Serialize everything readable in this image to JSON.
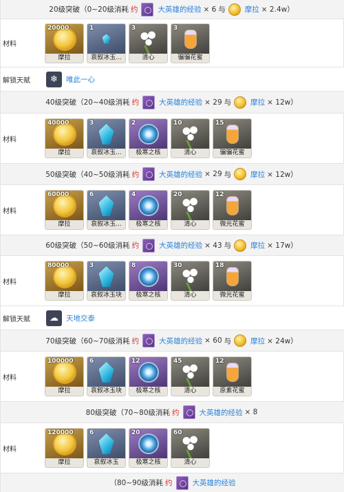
{
  "headers": [
    {
      "prefix": "20级突破（0~20级消耗",
      "yue": "约",
      "exp": "大英雄的经验",
      "exp_count": "× 6",
      "yu": "与",
      "mora": "摩拉",
      "mora_count": "× 2.4w）"
    },
    {
      "prefix": "40级突破（20~40级消耗",
      "yue": "约",
      "exp": "大英雄的经验",
      "exp_count": "× 29",
      "yu": "与",
      "mora": "摩拉",
      "mora_count": "× 12w）"
    },
    {
      "prefix": "50级突破（40~50级消耗",
      "yue": "约",
      "exp": "大英雄的经验",
      "exp_count": "× 29",
      "yu": "与",
      "mora": "摩拉",
      "mora_count": "× 12w）"
    },
    {
      "prefix": "60级突破（50~60级消耗",
      "yue": "约",
      "exp": "大英雄的经验",
      "exp_count": "× 43",
      "yu": "与",
      "mora": "摩拉",
      "mora_count": "× 17w）"
    },
    {
      "prefix": "70级突破（60~70级消耗",
      "yue": "约",
      "exp": "大英雄的经验",
      "exp_count": "× 60",
      "yu": "与",
      "mora": "摩拉",
      "mora_count": "× 24w）"
    },
    {
      "prefix": "80级突破（70~80级消耗",
      "yue": "约",
      "exp": "大英雄的经验",
      "exp_count": "× 8",
      "yu": "",
      "mora": "",
      "mora_count": ""
    },
    {
      "prefix": "（80~90级消耗",
      "yue": "约",
      "exp": "大英雄的经验",
      "exp_count": "",
      "yu": "",
      "mora": "",
      "mora_count": ""
    }
  ],
  "labels": {
    "material": "材料",
    "unlock_talent": "解锁天赋"
  },
  "talents": [
    {
      "name": "唯此一心",
      "icon": "snowflake-talent-icon"
    },
    {
      "name": "天地交泰",
      "icon": "cloud-talent-icon"
    }
  ],
  "materials": [
    [
      {
        "count": "20000",
        "name": "摩拉",
        "icon": "coin"
      },
      {
        "count": "1",
        "name": "哀叙冰玉...",
        "icon": "crystal-small"
      },
      {
        "count": "3",
        "name": "清心",
        "icon": "flower"
      },
      {
        "count": "3",
        "name": "骗骗花蜜",
        "icon": "bottle"
      }
    ],
    [
      {
        "count": "40000",
        "name": "摩拉",
        "icon": "coin"
      },
      {
        "count": "3",
        "name": "哀叙冰玉...",
        "icon": "crystal"
      },
      {
        "count": "2",
        "name": "极寒之核",
        "icon": "core"
      },
      {
        "count": "10",
        "name": "清心",
        "icon": "flower"
      },
      {
        "count": "15",
        "name": "骗骗花蜜",
        "icon": "bottle"
      }
    ],
    [
      {
        "count": "60000",
        "name": "摩拉",
        "icon": "coin"
      },
      {
        "count": "6",
        "name": "哀叙冰玉...",
        "icon": "crystal"
      },
      {
        "count": "4",
        "name": "极寒之核",
        "icon": "core"
      },
      {
        "count": "20",
        "name": "清心",
        "icon": "flower"
      },
      {
        "count": "12",
        "name": "微光花蜜",
        "icon": "bottle"
      }
    ],
    [
      {
        "count": "80000",
        "name": "摩拉",
        "icon": "coin"
      },
      {
        "count": "3",
        "name": "哀叙冰玉块",
        "icon": "crystal"
      },
      {
        "count": "8",
        "name": "极寒之核",
        "icon": "core"
      },
      {
        "count": "30",
        "name": "清心",
        "icon": "flower"
      },
      {
        "count": "18",
        "name": "微光花蜜",
        "icon": "bottle"
      }
    ],
    [
      {
        "count": "100000",
        "name": "摩拉",
        "icon": "coin"
      },
      {
        "count": "6",
        "name": "哀叙冰玉块",
        "icon": "crystal"
      },
      {
        "count": "12",
        "name": "极寒之核",
        "icon": "core"
      },
      {
        "count": "45",
        "name": "清心",
        "icon": "flower"
      },
      {
        "count": "12",
        "name": "原素花蜜",
        "icon": "bottle"
      }
    ],
    [
      {
        "count": "120000",
        "name": "摩拉",
        "icon": "coin"
      },
      {
        "count": "6",
        "name": "哀叙冰玉",
        "icon": "crystal"
      },
      {
        "count": "20",
        "name": "极寒之核",
        "icon": "core"
      },
      {
        "count": "60",
        "name": "清心",
        "icon": "flower"
      }
    ]
  ]
}
